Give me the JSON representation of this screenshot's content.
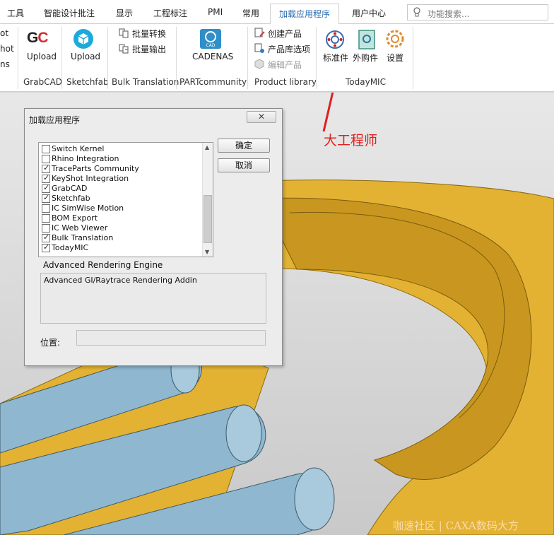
{
  "tabs": [
    "工具",
    "智能设计批注",
    "显示",
    "工程标注",
    "PMI",
    "常用",
    "加载应用程序",
    "用户中心"
  ],
  "active_tab": "加载应用程序",
  "search": {
    "placeholder": "功能搜索..."
  },
  "ribbon": {
    "cut_items": [
      "ot",
      "hot",
      "ns"
    ],
    "groups": [
      {
        "name": "GrabCAD",
        "buttons": [
          "Upload"
        ]
      },
      {
        "name": "Sketchfab",
        "buttons": [
          "Upload"
        ]
      },
      {
        "name": "Bulk Translation",
        "items": [
          "批量转换",
          "批量输出"
        ]
      },
      {
        "name": "PARTcommunity",
        "buttons": [
          "CADENAS"
        ]
      },
      {
        "name": "Product library",
        "items": [
          "创建产品",
          "产品库选项",
          "编辑产品"
        ],
        "disabled_item": "编辑产品"
      },
      {
        "name": "TodayMIC",
        "buttons": [
          "标准件",
          "外购件",
          "设置"
        ]
      }
    ]
  },
  "dialog": {
    "title": "加载应用程序",
    "close_label": "✕",
    "items": [
      {
        "label": "Switch Kernel",
        "checked": false
      },
      {
        "label": "Rhino Integration",
        "checked": false
      },
      {
        "label": "TraceParts Community",
        "checked": true
      },
      {
        "label": "KeyShot Integration",
        "checked": true
      },
      {
        "label": "GrabCAD",
        "checked": true
      },
      {
        "label": "Sketchfab",
        "checked": true
      },
      {
        "label": "IC SimWise Motion",
        "checked": false
      },
      {
        "label": "BOM Export",
        "checked": false
      },
      {
        "label": "IC Web Viewer",
        "checked": false
      },
      {
        "label": "Bulk Translation",
        "checked": true
      },
      {
        "label": "TodayMIC",
        "checked": true
      }
    ],
    "ok_label": "确定",
    "cancel_label": "取消",
    "section_title": "Advanced Rendering Engine",
    "description": "Advanced GI/Raytrace Rendering Addin",
    "location_label": "位置:",
    "location_value": ""
  },
  "annotation": "大工程师",
  "watermark": "咖速社区 | CAXA数码大方",
  "colors": {
    "accent": "#2b6cb0",
    "annotation": "#e02020",
    "part": "#e6b52e",
    "shaft": "#8fb7cf"
  }
}
